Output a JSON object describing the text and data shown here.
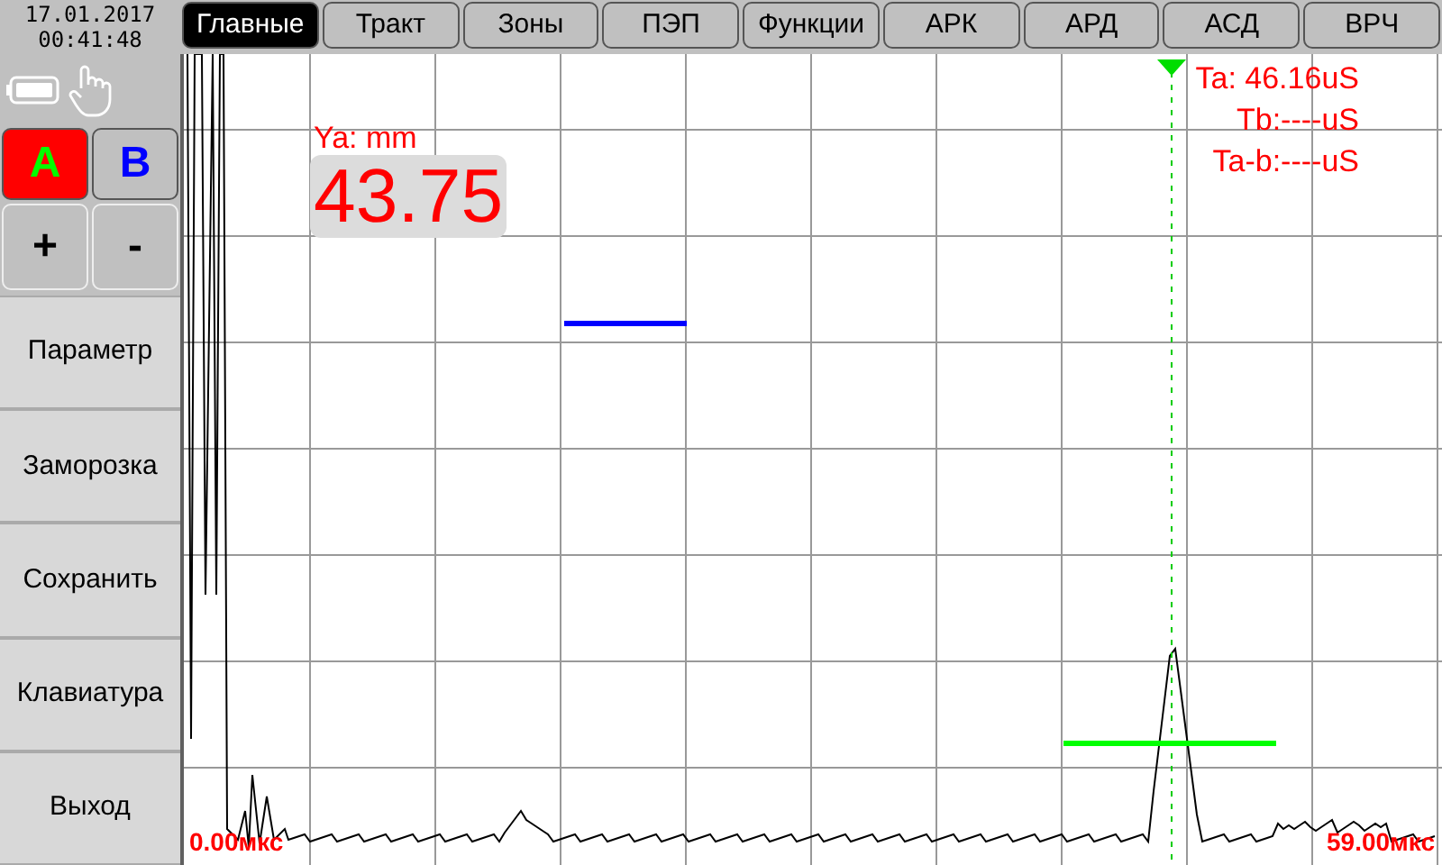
{
  "clock": {
    "date": "17.01.2017",
    "time": "00:41:48"
  },
  "gates": [
    {
      "label": "A",
      "selected": true,
      "color": "#00ff00"
    },
    {
      "label": "B",
      "selected": false,
      "color": "#0000ff"
    }
  ],
  "adjust_buttons": [
    "+",
    "-"
  ],
  "menu": [
    "Параметр",
    "Заморозка",
    "Сохранить",
    "Клавиатура",
    "Выход"
  ],
  "tabs": [
    {
      "label": "Главные",
      "selected": true
    },
    {
      "label": "Тракт",
      "selected": false
    },
    {
      "label": "Зоны",
      "selected": false
    },
    {
      "label": "ПЭП",
      "selected": false
    },
    {
      "label": "Функции",
      "selected": false
    },
    {
      "label": "АРК",
      "selected": false
    },
    {
      "label": "АРД",
      "selected": false
    },
    {
      "label": "АСД",
      "selected": false
    },
    {
      "label": "ВРЧ",
      "selected": false
    }
  ],
  "readout": {
    "label": "Ya: mm",
    "value": "43.75"
  },
  "cursor_times": [
    "Ta: 46.16uS",
    "Tb:----uS",
    "Ta-b:----uS"
  ],
  "axis": {
    "start": "0.00мкс",
    "end": "59.00мкс"
  }
}
